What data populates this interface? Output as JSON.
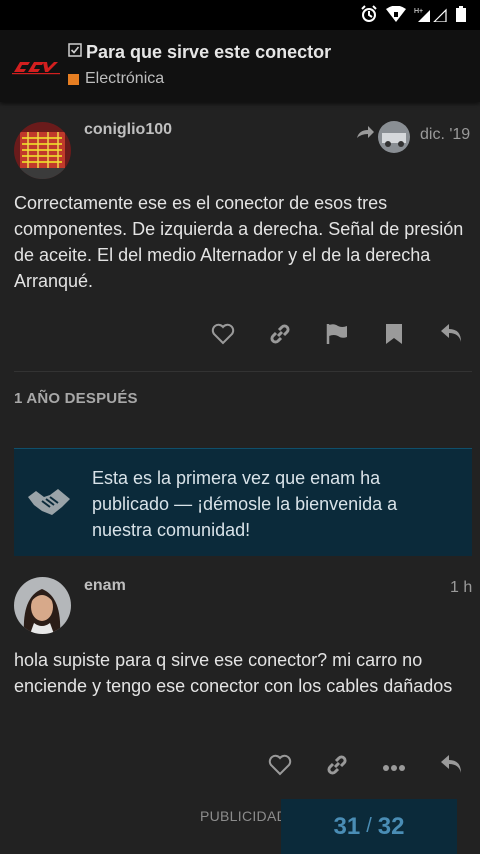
{
  "topic": {
    "title": "Para que sirve este conector",
    "category": "Electrónica",
    "category_color": "#e67e22"
  },
  "posts": [
    {
      "username": "coniglio100",
      "time": "dic. '19",
      "body": "Correctamente ese es el conector de esos tres componentes. De izquierda a derecha. Señal de presión de aceite. El del medio Alternador y el de la derecha Arranqué."
    },
    {
      "username": "enam",
      "time": "1 h",
      "body": "hola supiste para q sirve ese conector? mi carro no enciende y tengo ese conector con los cables dañados"
    }
  ],
  "small_action": "1 AÑO DESPUÉS",
  "welcome_notice": "Esta es la primera vez que enam ha publicado — ¡démosle la bienvenida a nuestra comunidad!",
  "footer": {
    "publicidad": "PUBLICIDAD",
    "progress_current": "31",
    "progress_separator": "/",
    "progress_total": "32"
  },
  "icons": {
    "status": [
      "alarm-icon",
      "wifi-icon",
      "signal-icon",
      "battery-icon"
    ],
    "post_actions": [
      "heart-icon",
      "link-icon",
      "flag-icon",
      "bookmark-icon",
      "reply-icon"
    ],
    "post2_actions": [
      "heart-icon",
      "link-icon",
      "more-icon",
      "reply-icon"
    ]
  },
  "colors": {
    "background": "#222222",
    "header": "#111111",
    "welcome_bg": "#0b2a3a",
    "accent": "#4a8db5"
  }
}
